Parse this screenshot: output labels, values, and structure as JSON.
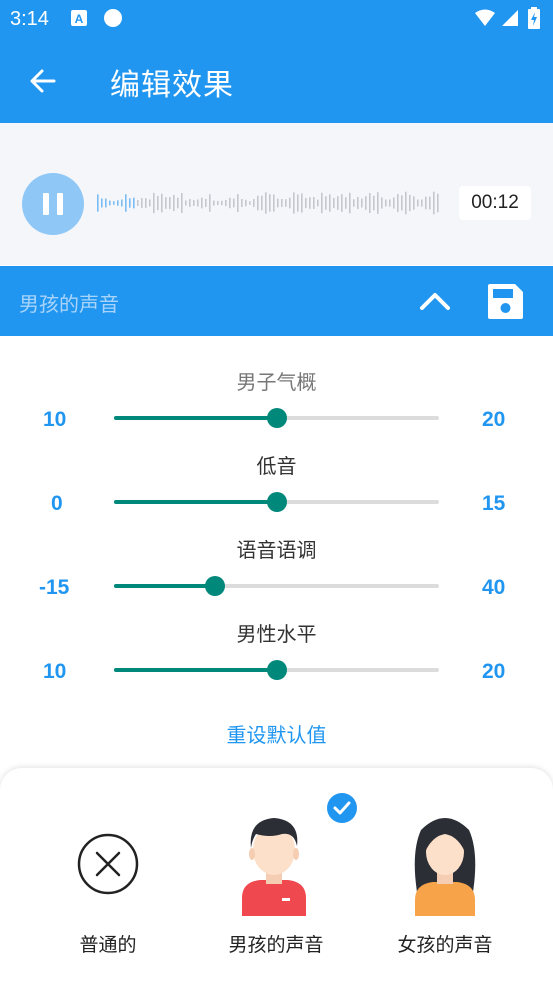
{
  "status": {
    "time": "3:14"
  },
  "appbar": {
    "title": "编辑效果"
  },
  "player": {
    "time": "00:12"
  },
  "section": {
    "title": "男孩的声音"
  },
  "sliders": [
    {
      "label": "男子气概",
      "min": "10",
      "max": "20",
      "level": 0.5
    },
    {
      "label": "低音",
      "min": "0",
      "max": "15",
      "level": 0.5
    },
    {
      "label": "语音语调",
      "min": "-15",
      "max": "40",
      "level": 0.31
    },
    {
      "label": "男性水平",
      "min": "10",
      "max": "20",
      "level": 0.5
    }
  ],
  "reset_label": "重设默认值",
  "effects": [
    {
      "label": "普通的",
      "icon": "cancel-circle-icon",
      "selected": false
    },
    {
      "label": "男孩的声音",
      "icon": "boy-avatar-icon",
      "selected": true
    },
    {
      "label": "女孩的声音",
      "icon": "girl-avatar-icon",
      "selected": false
    }
  ],
  "colors": {
    "primary": "#2196f0",
    "slider": "#00897b"
  }
}
